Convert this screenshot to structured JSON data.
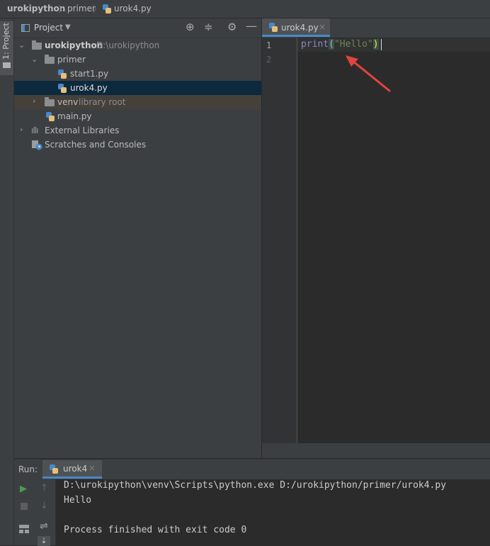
{
  "breadcrumb": {
    "project": "urokipython",
    "folder": "primer",
    "file": "urok4.py"
  },
  "tool_stripe": {
    "label": "1: Project"
  },
  "project_panel": {
    "title": "Project",
    "tree": {
      "root_name": "urokipython",
      "root_path": "D:\\urokipython",
      "primer": "primer",
      "start1": "start1.py",
      "urok4": "urok4.py",
      "venv": "venv",
      "venv_hint": "library root",
      "main": "main.py",
      "external": "External Libraries",
      "scratches": "Scratches and Consoles"
    }
  },
  "editor": {
    "tab_label": "urok4.py",
    "line_numbers": [
      "1",
      "2"
    ],
    "code": {
      "fn": "print",
      "open": "(",
      "str": "\"Hello\"",
      "close": ")"
    }
  },
  "run_panel": {
    "label": "Run:",
    "tab_label": "urok4",
    "command": "D:\\urokipython\\venv\\Scripts\\python.exe D:/urokipython/primer/urok4.py",
    "output": "Hello",
    "exit_message": "Process finished with exit code 0"
  },
  "colors": {
    "accent": "#4a88c7",
    "selection": "#0d293e",
    "keyword_fn": "#8888c6",
    "string": "#6a8759",
    "arrow": "#e0443e",
    "run_green": "#499c54"
  }
}
